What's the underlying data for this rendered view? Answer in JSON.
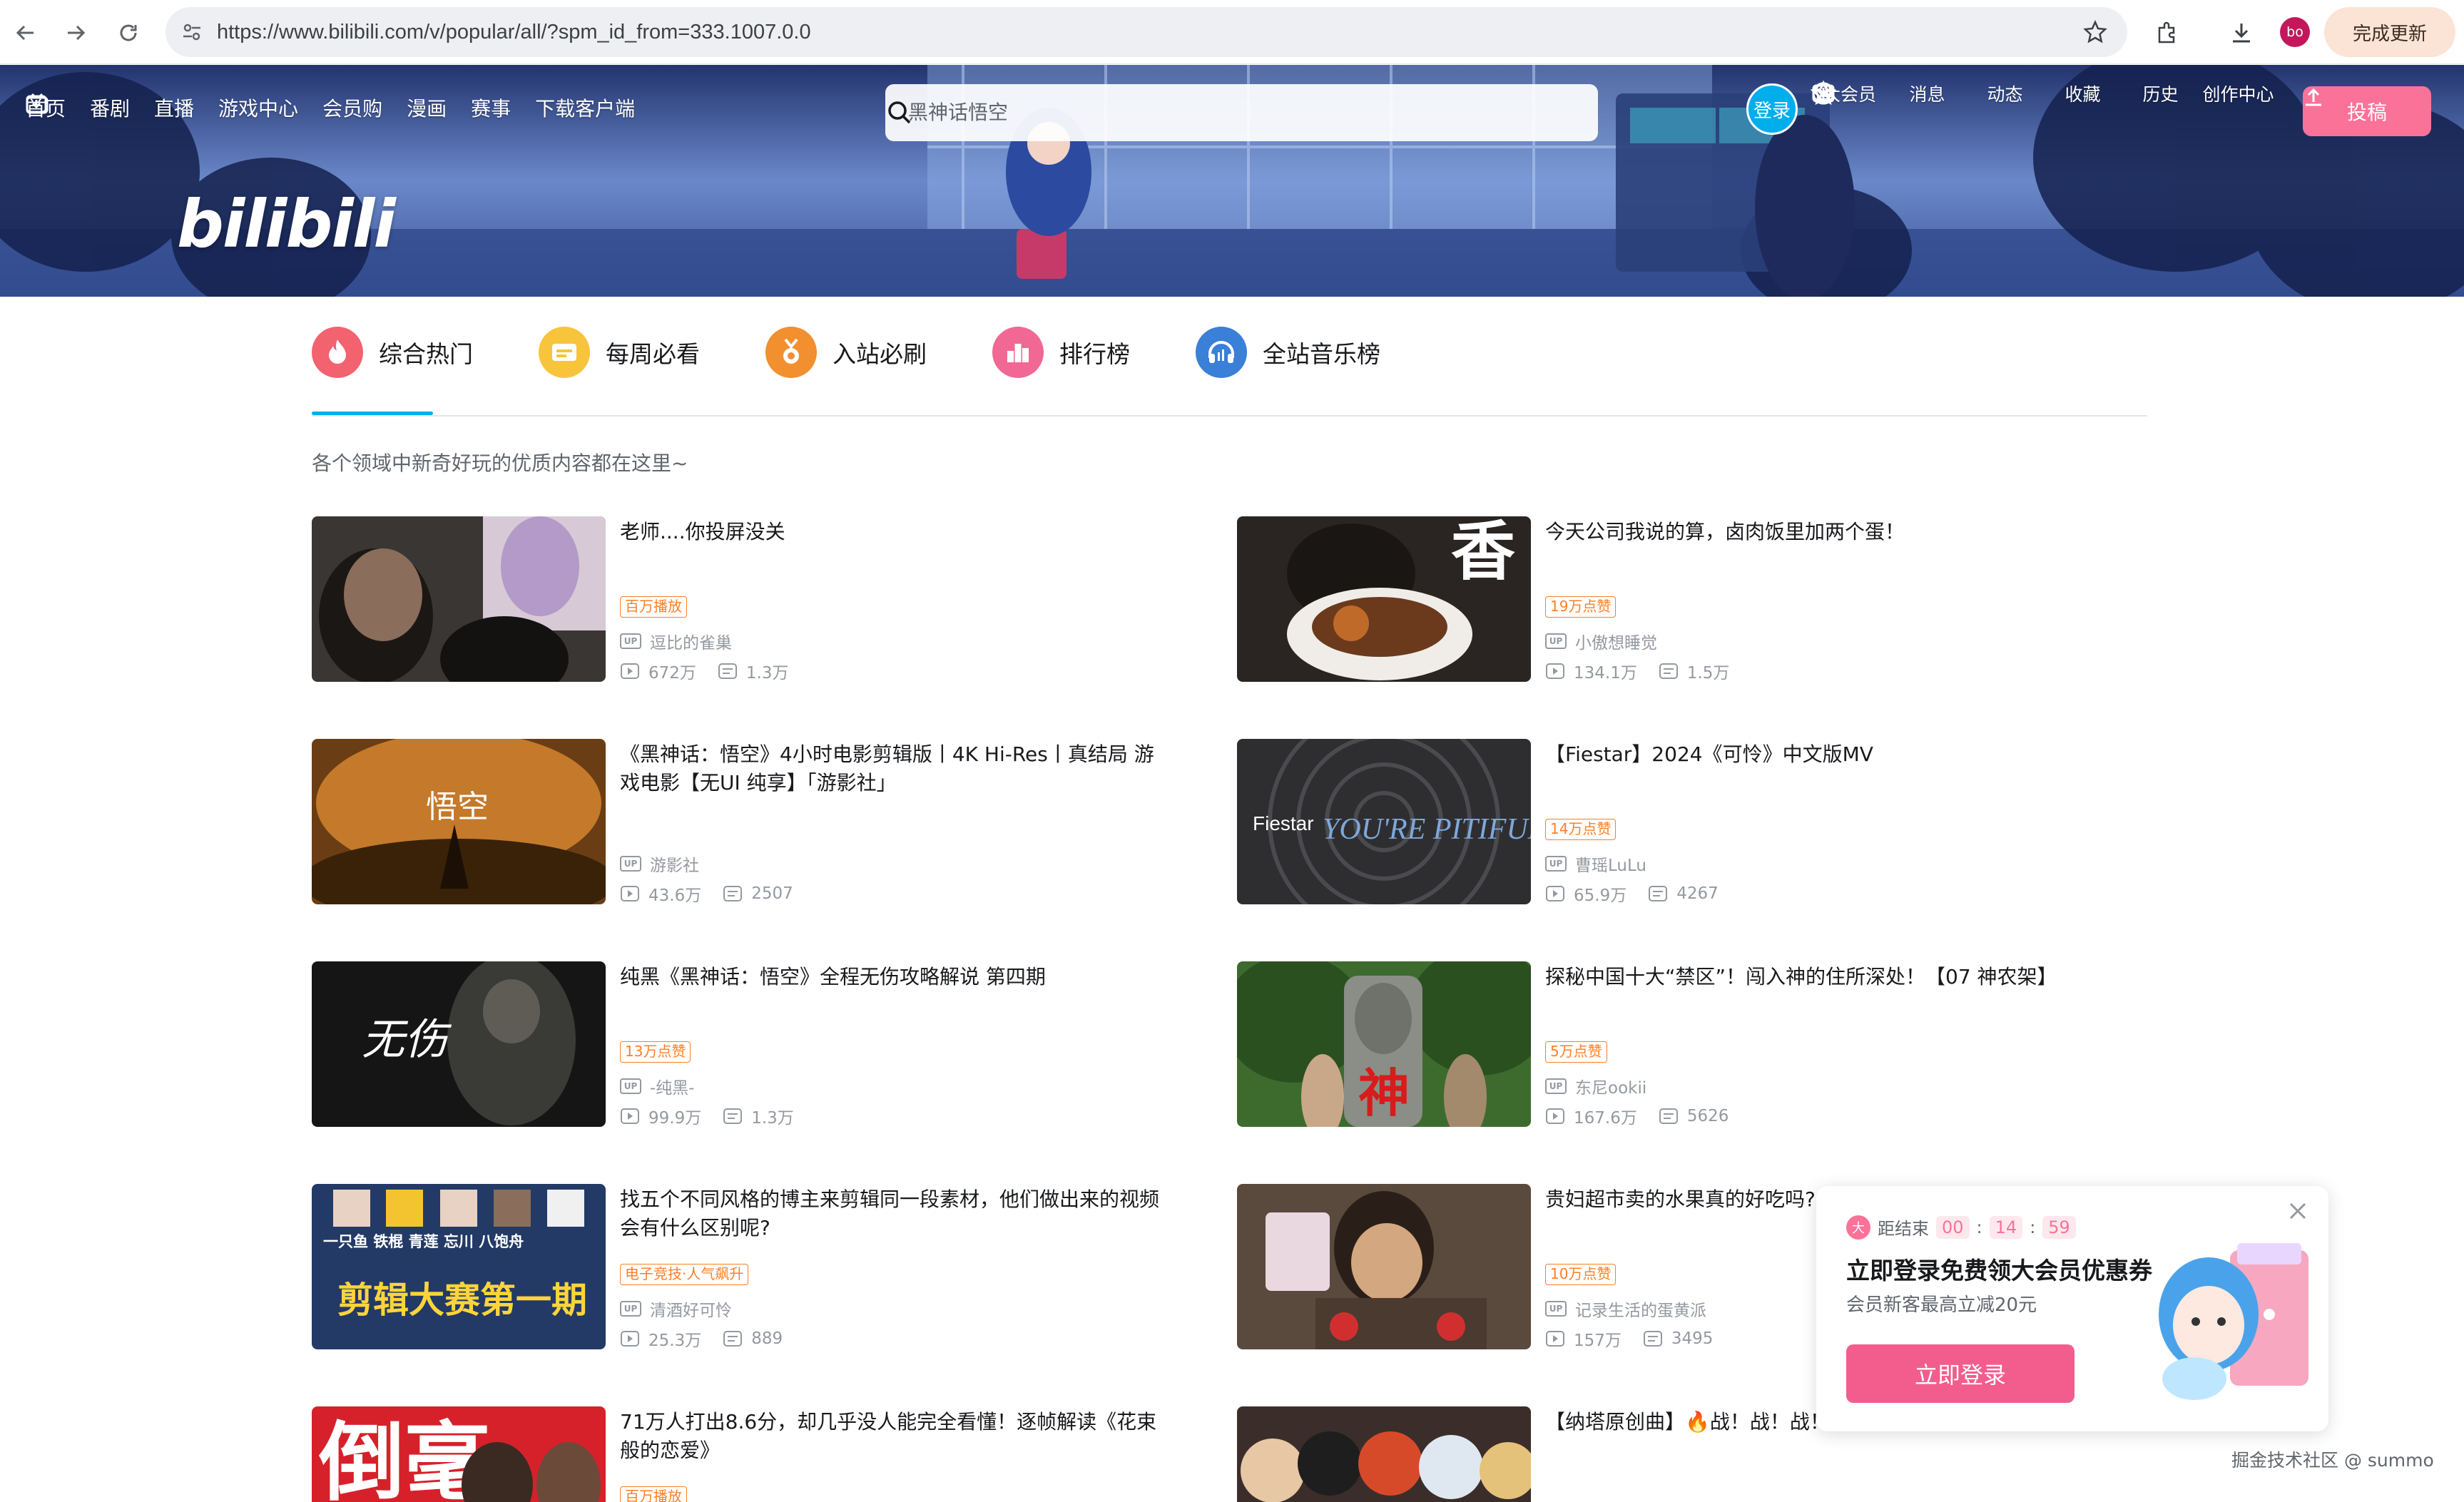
{
  "browser": {
    "url": "https://www.bilibili.com/v/popular/all/?spm_id_from=333.1007.0.0",
    "avatar": "bo",
    "update_label": "完成更新"
  },
  "header": {
    "nav": [
      {
        "label": "首页",
        "icon": "tv-icon"
      },
      {
        "label": "番剧"
      },
      {
        "label": "直播"
      },
      {
        "label": "游戏中心"
      },
      {
        "label": "会员购"
      },
      {
        "label": "漫画"
      },
      {
        "label": "赛事"
      },
      {
        "label": "下载客户端",
        "icon": "download-icon"
      }
    ],
    "search_placeholder": "黑神话悟空",
    "login": "登录",
    "right_items": [
      {
        "label": "大会员",
        "icon": "vip-icon"
      },
      {
        "label": "消息",
        "icon": "message-icon"
      },
      {
        "label": "动态",
        "icon": "dynamic-icon"
      },
      {
        "label": "收藏",
        "icon": "star-icon"
      },
      {
        "label": "历史",
        "icon": "clock-icon"
      },
      {
        "label": "创作中心",
        "icon": "bulb-icon"
      }
    ],
    "upload": "投稿",
    "logo": "bilibili"
  },
  "tabs": [
    {
      "label": "综合热门",
      "color": "#f2626f",
      "icon": "fire-icon"
    },
    {
      "label": "每周必看",
      "color": "#f8c43b",
      "icon": "calendar-icon"
    },
    {
      "label": "入站必刷",
      "color": "#f28f2f",
      "icon": "medal-icon"
    },
    {
      "label": "排行榜",
      "color": "#f06893",
      "icon": "rank-icon"
    },
    {
      "label": "全站音乐榜",
      "color": "#3a7fd8",
      "icon": "headphones-icon"
    }
  ],
  "subtitle": "各个领域中新奇好玩的优质内容都在这里~",
  "videos": [
    {
      "title": "老师....你投屏没关",
      "badge": "百万播放",
      "up": "逗比的雀巢",
      "views": "672万",
      "comments": "1.3万"
    },
    {
      "title": "今天公司我说的算，卤肉饭里加两个蛋！",
      "badge": "19万点赞",
      "up": "小傲想睡觉",
      "views": "134.1万",
      "comments": "1.5万"
    },
    {
      "title": "《黑神话：悟空》4小时电影剪辑版丨4K Hi-Res丨真结局 游戏电影【无UI 纯享】「游影社」",
      "badge": "",
      "up": "游影社",
      "views": "43.6万",
      "comments": "2507"
    },
    {
      "title": "【Fiestar】2024《可怜》中文版MV",
      "badge": "14万点赞",
      "up": "曹瑶LuLu",
      "views": "65.9万",
      "comments": "4267"
    },
    {
      "title": "纯黑《黑神话：悟空》全程无伤攻略解说 第四期",
      "badge": "13万点赞",
      "up": "-纯黑-",
      "views": "99.9万",
      "comments": "1.3万"
    },
    {
      "title": "探秘中国十大“禁区”！闯入神的住所深处！【07 神农架】",
      "badge": "5万点赞",
      "up": "东尼ookii",
      "views": "167.6万",
      "comments": "5626"
    },
    {
      "title": "找五个不同风格的博主来剪辑同一段素材，他们做出来的视频会有什么区别呢?",
      "badge": "电子竞技·人气飙升",
      "up": "清酒好可怜",
      "views": "25.3万",
      "comments": "889"
    },
    {
      "title": "贵妇超市卖的水果真的好吃吗?",
      "badge": "10万点赞",
      "up": "记录生活的蛋黄派",
      "views": "157万",
      "comments": "3495"
    },
    {
      "title": "71万人打出8.6分，却几乎没人能完全看懂！逐帧解读《花束般的恋爱》",
      "badge": "百万播放",
      "up": "",
      "views": "",
      "comments": ""
    },
    {
      "title": "【纳塔原创曲】🔥战！战！战！",
      "badge": "",
      "up": "",
      "views": "",
      "comments": ""
    }
  ],
  "thumb_text": {
    "v2": "香",
    "v3": "悟空",
    "v4_a": "Fiestar",
    "v4_b": "YOU'RE PITIFUL",
    "v5": "无伤",
    "v6": "神",
    "v7_names": "一只鱼  铁棍  青莲  忘川  八饱舟",
    "v7_big": "剪辑大赛第一期",
    "v9": "倒毫"
  },
  "popup": {
    "ends_label": "距结束",
    "timer": [
      "00",
      "14",
      "59"
    ],
    "title": "立即登录免费领大会员优惠券",
    "subtitle": "会员新客最高立减20元",
    "button": "立即登录"
  },
  "watermark": "掘金技术社区 @ summo"
}
